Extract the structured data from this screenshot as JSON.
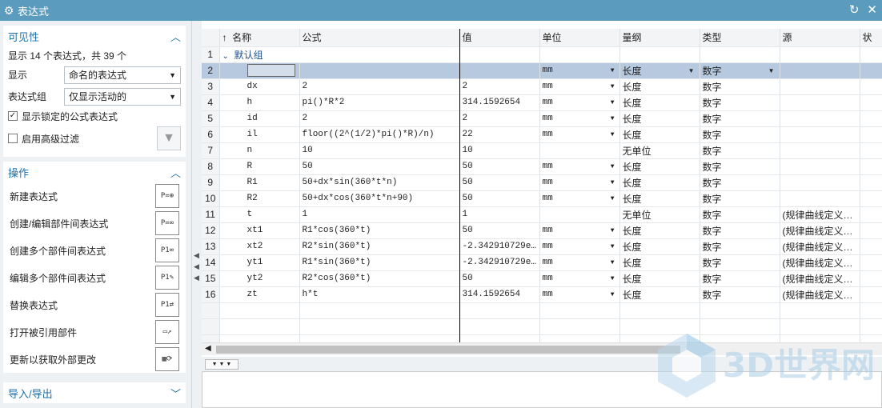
{
  "window": {
    "title": "表达式"
  },
  "visibility": {
    "title": "可见性",
    "count_text": "显示 14 个表达式，共 39 个",
    "display_label": "显示",
    "display_value": "命名的表达式",
    "group_label": "表达式组",
    "group_value": "仅显示活动的",
    "show_locked_label": "显示锁定的公式表达式",
    "advanced_filter_label": "启用高级过滤"
  },
  "operations": {
    "title": "操作",
    "items": [
      {
        "label": "新建表达式",
        "icon": "new-expression-icon"
      },
      {
        "label": "创建/编辑部件间表达式",
        "icon": "interpart-link-icon"
      },
      {
        "label": "创建多个部件间表达式",
        "icon": "multi-interpart-icon"
      },
      {
        "label": "编辑多个部件间表达式",
        "icon": "edit-interpart-icon"
      },
      {
        "label": "替换表达式",
        "icon": "replace-expression-icon"
      },
      {
        "label": "打开被引用部件",
        "icon": "open-folder-icon"
      },
      {
        "label": "更新以获取外部更改",
        "icon": "spreadsheet-update-icon"
      }
    ]
  },
  "import_export": {
    "title": "导入/导出"
  },
  "table": {
    "columns": [
      "名称",
      "公式",
      "值",
      "单位",
      "量纲",
      "类型",
      "源",
      "状"
    ],
    "group_row": {
      "num": "1",
      "label": "默认组"
    },
    "rows": [
      {
        "num": "2",
        "name": "",
        "formula": "",
        "value": "",
        "unit": "mm",
        "dim": "长度",
        "type": "数字",
        "source": ""
      },
      {
        "num": "3",
        "name": "dx",
        "formula": "2",
        "value": "2",
        "unit": "mm",
        "dim": "长度",
        "type": "数字",
        "source": ""
      },
      {
        "num": "4",
        "name": "h",
        "formula": "pi()*R*2",
        "value": "314.1592654",
        "unit": "mm",
        "dim": "长度",
        "type": "数字",
        "source": ""
      },
      {
        "num": "5",
        "name": "id",
        "formula": "2",
        "value": "2",
        "unit": "mm",
        "dim": "长度",
        "type": "数字",
        "source": ""
      },
      {
        "num": "6",
        "name": "il",
        "formula": "floor((2^(1/2)*pi()*R)/n)",
        "value": "22",
        "unit": "mm",
        "dim": "长度",
        "type": "数字",
        "source": ""
      },
      {
        "num": "7",
        "name": "n",
        "formula": "10",
        "value": "10",
        "unit": "",
        "dim": "无单位",
        "type": "数字",
        "source": ""
      },
      {
        "num": "8",
        "name": "R",
        "formula": "50",
        "value": "50",
        "unit": "mm",
        "dim": "长度",
        "type": "数字",
        "source": ""
      },
      {
        "num": "9",
        "name": "R1",
        "formula": "50+dx*sin(360*t*n)",
        "value": "50",
        "unit": "mm",
        "dim": "长度",
        "type": "数字",
        "source": ""
      },
      {
        "num": "10",
        "name": "R2",
        "formula": "50+dx*cos(360*t*n+90)",
        "value": "50",
        "unit": "mm",
        "dim": "长度",
        "type": "数字",
        "source": ""
      },
      {
        "num": "11",
        "name": "t",
        "formula": "1",
        "value": "1",
        "unit": "",
        "dim": "无单位",
        "type": "数字",
        "source": "(规律曲线定义…"
      },
      {
        "num": "12",
        "name": "xt1",
        "formula": "R1*cos(360*t)",
        "value": "50",
        "unit": "mm",
        "dim": "长度",
        "type": "数字",
        "source": "(规律曲线定义…"
      },
      {
        "num": "13",
        "name": "xt2",
        "formula": "R2*sin(360*t)",
        "value": "-2.342910729e…",
        "unit": "mm",
        "dim": "长度",
        "type": "数字",
        "source": "(规律曲线定义…"
      },
      {
        "num": "14",
        "name": "yt1",
        "formula": "R1*sin(360*t)",
        "value": "-2.342910729e…",
        "unit": "mm",
        "dim": "长度",
        "type": "数字",
        "source": "(规律曲线定义…"
      },
      {
        "num": "15",
        "name": "yt2",
        "formula": "R2*cos(360*t)",
        "value": "50",
        "unit": "mm",
        "dim": "长度",
        "type": "数字",
        "source": "(规律曲线定义…"
      },
      {
        "num": "16",
        "name": "zt",
        "formula": "h*t",
        "value": "314.1592654",
        "unit": "mm",
        "dim": "长度",
        "type": "数字",
        "source": "(规律曲线定义…"
      }
    ]
  },
  "watermark": {
    "text": "3D世界网"
  }
}
